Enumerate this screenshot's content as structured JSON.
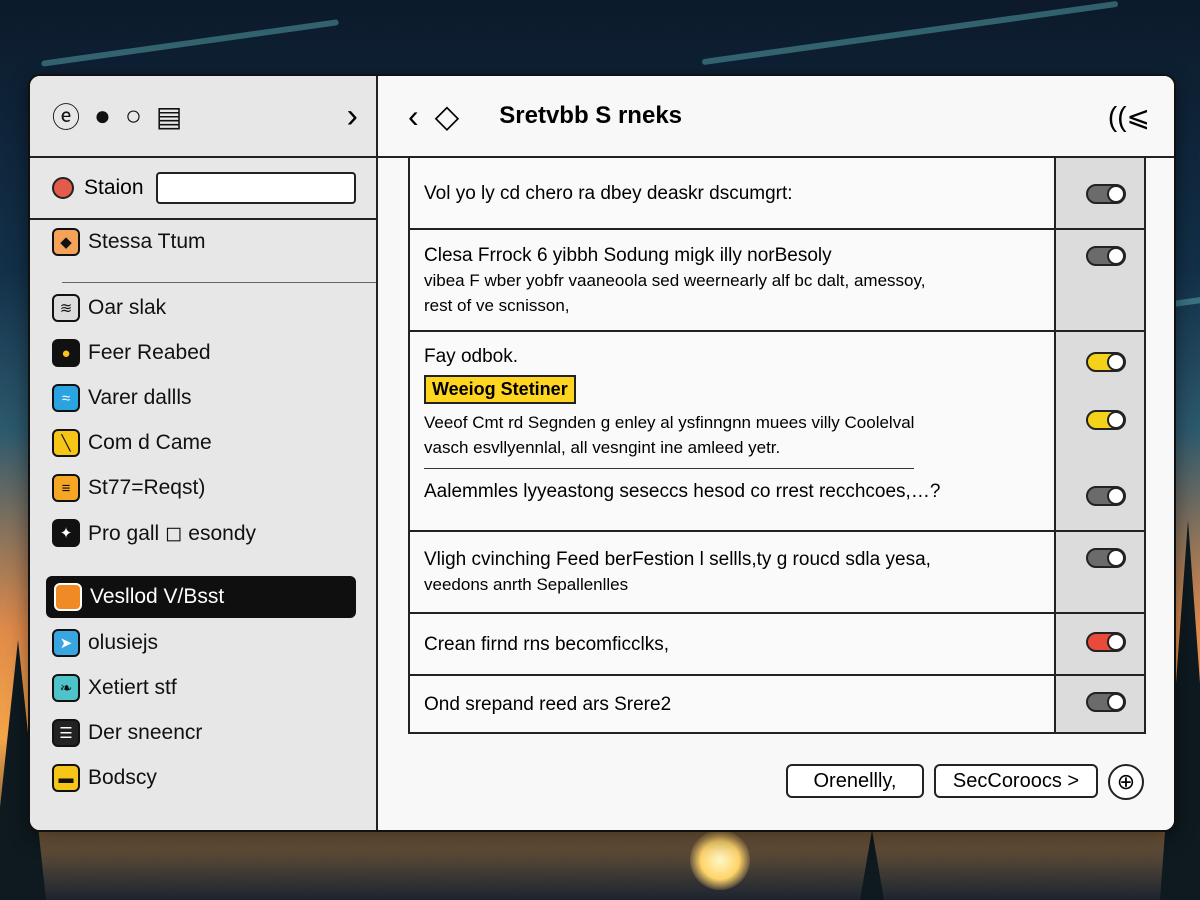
{
  "sidebar": {
    "search_label": "Staion",
    "search_value": "",
    "items": [
      {
        "label": "Stessa Ttum",
        "icon": "shield-icon",
        "color": "#f4a259"
      },
      {
        "label": "Oar slak",
        "icon": "pattern-icon",
        "color": "#dddddd"
      },
      {
        "label": "Feer Reabed",
        "icon": "circle-icon",
        "color": "#f5c518"
      },
      {
        "label": "Varer dallls",
        "icon": "wave-icon",
        "color": "#2aa4e0"
      },
      {
        "label": "Com d Came",
        "icon": "slash-icon",
        "color": "#f5c518"
      },
      {
        "label": "St77=Reqst)",
        "icon": "flag-icon",
        "color": "#f5a623"
      },
      {
        "label": "Pro gall ◻ esondy",
        "icon": "star-icon",
        "color": "#111111"
      },
      {
        "label": "Vesllod V/Bsst",
        "icon": "doc-icon",
        "color": "#f08a24",
        "active": true
      },
      {
        "label": "olusiejs",
        "icon": "plane-icon",
        "color": "#3aa6e0"
      },
      {
        "label": "Xetiert stf",
        "icon": "leaf-icon",
        "color": "#4ec3c9"
      },
      {
        "label": "Der sneencr",
        "icon": "list-icon",
        "color": "#222222"
      },
      {
        "label": "Bodscy",
        "icon": "box-icon",
        "color": "#f5c518"
      }
    ]
  },
  "header": {
    "title": "Sretvbb S rneks",
    "right_glyph": "((⩽"
  },
  "rows": [
    {
      "lines": [
        "Vol yo ly cd chero ra dbey deaskr dscumgrt:"
      ]
    },
    {
      "lines": [
        "Clesa Frrock 6 yibbh Sodung migk illy norBesoly",
        "vibea F wber yobfr vaaneoola sed weernearly alf bc dalt, amessoy,",
        "rest of ve scnisson,"
      ]
    },
    {
      "lines": [
        "Fay odbok."
      ],
      "highlight": "Weeiog Stetiner",
      "lines2": [
        "Veeof Cmt rd Segnden g enley al ysfinngnn muees villy Coolelval",
        "vasch esvllyennlal, all vesngint ine amleed yetr."
      ]
    },
    {
      "lines": [
        "Aalemmles lyyeastong seseccs hesod co rrest recchcoes,…?"
      ]
    },
    {
      "lines": [
        "Vligh cvinching Feed berFestion l sellls,ty g roucd sdla yesa,",
        "veedons anrth Sepallenlles"
      ]
    },
    {
      "lines": [
        "Crean firnd rns becomficclks,"
      ]
    },
    {
      "lines": [
        "Ond srepand reed ars Srere2"
      ]
    }
  ],
  "toggles": [
    {
      "state": "off",
      "color": "#6b6b6b"
    },
    {
      "state": "off",
      "color": "#6b6b6b"
    },
    {
      "state": "on",
      "color": "#f5d21a"
    },
    {
      "state": "on",
      "color": "#f5d21a"
    },
    {
      "state": "off",
      "color": "#6b6b6b"
    },
    {
      "state": "off",
      "color": "#6b6b6b"
    },
    {
      "state": "on",
      "color": "#e84a3c"
    },
    {
      "state": "off",
      "color": "#6b6b6b"
    }
  ],
  "footer": {
    "btn1": "Orenellly,",
    "btn2": "SecCoroocs >",
    "btn3_icon": "cursor-icon"
  }
}
